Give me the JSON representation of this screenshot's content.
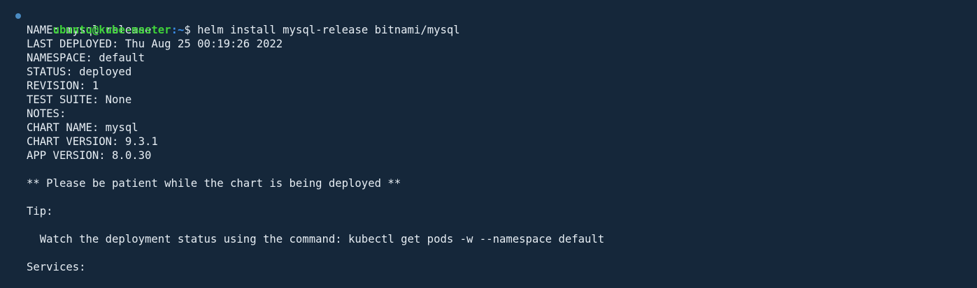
{
  "prompt": {
    "user_host": "ubuntu@kube-master",
    "path": ":~",
    "symbol": "$ ",
    "command": "helm install mysql-release bitnami/mysql"
  },
  "output": [
    "NAME: mysql-release",
    "LAST DEPLOYED: Thu Aug 25 00:19:26 2022",
    "NAMESPACE: default",
    "STATUS: deployed",
    "REVISION: 1",
    "TEST SUITE: None",
    "NOTES:",
    "CHART NAME: mysql",
    "CHART VERSION: 9.3.1",
    "APP VERSION: 8.0.30",
    "",
    "** Please be patient while the chart is being deployed **",
    "",
    "Tip:",
    "",
    "  Watch the deployment status using the command: kubectl get pods -w --namespace default",
    "",
    "Services:"
  ],
  "colors": {
    "background": "#15273a",
    "text": "#e6edf3",
    "user_host": "#3fd23a",
    "path": "#3b8eea",
    "status_dot": "#4a8bc2"
  }
}
